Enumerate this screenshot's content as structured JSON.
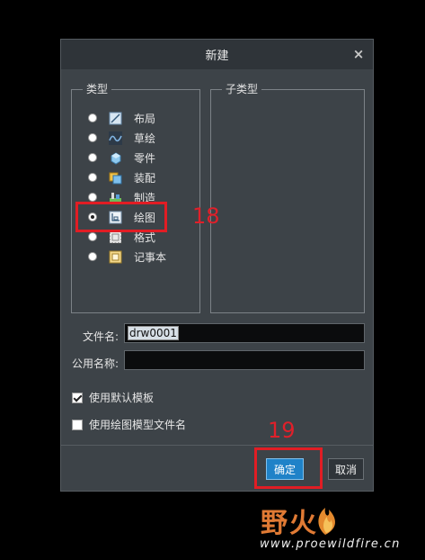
{
  "dialog": {
    "title": "新建",
    "close_symbol": "×",
    "type_group": {
      "legend": "类型",
      "items": [
        {
          "label": "布局",
          "icon": "layout-icon",
          "selected": false
        },
        {
          "label": "草绘",
          "icon": "sketch-icon",
          "selected": false
        },
        {
          "label": "零件",
          "icon": "part-icon",
          "selected": false
        },
        {
          "label": "装配",
          "icon": "assembly-icon",
          "selected": false
        },
        {
          "label": "制造",
          "icon": "manufacturing-icon",
          "selected": false
        },
        {
          "label": "绘图",
          "icon": "drawing-icon",
          "selected": true
        },
        {
          "label": "格式",
          "icon": "format-icon",
          "selected": false
        },
        {
          "label": "记事本",
          "icon": "notebook-icon",
          "selected": false
        }
      ]
    },
    "subtype_group": {
      "legend": "子类型"
    },
    "filename": {
      "label": "文件名:",
      "value": "drw0001"
    },
    "common_name": {
      "label": "公用名称:",
      "value": ""
    },
    "options": {
      "use_default_template": {
        "label": "使用默认模板",
        "checked": true
      },
      "use_drawing_model_filename": {
        "label": "使用绘图模型文件名",
        "checked": false
      }
    },
    "buttons": {
      "ok": "确定",
      "cancel": "取消"
    }
  },
  "annotations": {
    "step_18": "18",
    "step_19": "19",
    "color": "#e11d24"
  },
  "watermark": {
    "text": "野火",
    "url": "www.proewildfire.cn"
  }
}
